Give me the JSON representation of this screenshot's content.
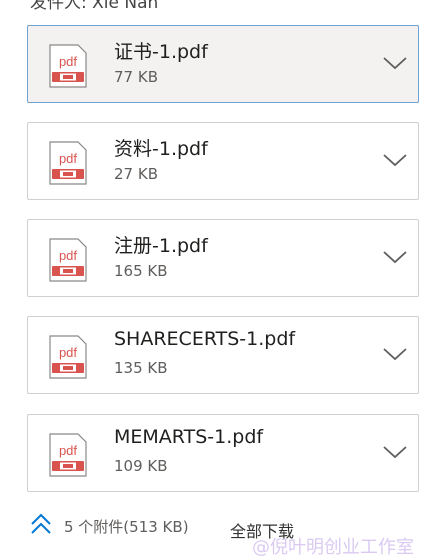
{
  "top_text": "发件人: Xie Nan",
  "attachments": [
    {
      "name": "证书-1.pdf",
      "size": "77 KB",
      "icon": "pdf-icon",
      "icon_label": "pdf"
    },
    {
      "name": "资料-1.pdf",
      "size": "27 KB",
      "icon": "pdf-icon",
      "icon_label": "pdf"
    },
    {
      "name": "注册-1.pdf",
      "size": "165 KB",
      "icon": "pdf-icon",
      "icon_label": "pdf"
    },
    {
      "name": "SHARECERTS-1.pdf",
      "size": "135 KB",
      "icon": "pdf-icon",
      "icon_label": "pdf"
    },
    {
      "name": "MEMARTS-1.pdf",
      "size": "109 KB",
      "icon": "pdf-icon",
      "icon_label": "pdf"
    }
  ],
  "footer": {
    "count_label": "5 个附件(513 KB)",
    "download_label": "全部下载",
    "collapse_icon": "double-chevron-up-icon"
  },
  "watermark": "@倪叶明创业工作室",
  "colors": {
    "accent": "#0078d4",
    "pdf_red": "#d9534f",
    "active_border": "#6fa2d0"
  }
}
